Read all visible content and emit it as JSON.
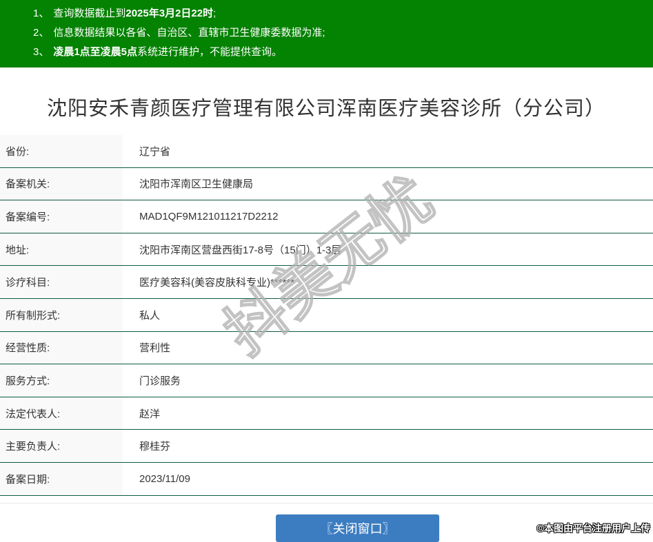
{
  "notice_bar": {
    "items": [
      {
        "num": "1、",
        "pre": "查询数据截止到",
        "bold": "2025年3月2日22时",
        "post": ";"
      },
      {
        "num": "2、",
        "pre": "信息数据结果以各省、自治区、直辖市卫生健康委数据为准;",
        "bold": "",
        "post": ""
      },
      {
        "num": "3、",
        "pre": "",
        "bold": "凌晨1点至凌晨5点",
        "post": "系统进行维护，不能提供查询。"
      }
    ]
  },
  "page_title": "沈阳安禾青颜医疗管理有限公司浑南医疗美容诊所（分公司）",
  "info_table": {
    "rows": [
      {
        "label": "省份:",
        "value": "辽宁省"
      },
      {
        "label": "备案机关:",
        "value": "沈阳市浑南区卫生健康局"
      },
      {
        "label": "备案编号:",
        "value": "MAD1QF9M121011217D2212"
      },
      {
        "label": "地址:",
        "value": "沈阳市浑南区营盘西街17-8号（15门）1-3层"
      },
      {
        "label": "诊疗科目:",
        "value": "医疗美容科(美容皮肤科专业)******"
      },
      {
        "label": "所有制形式:",
        "value": "私人"
      },
      {
        "label": "经营性质:",
        "value": "营利性"
      },
      {
        "label": "服务方式:",
        "value": "门诊服务"
      },
      {
        "label": "法定代表人:",
        "value": "赵洋"
      },
      {
        "label": "主要负责人:",
        "value": "穆桂芬"
      },
      {
        "label": "备案日期:",
        "value": "2023/11/09"
      }
    ]
  },
  "footer": {
    "close_button_label": "〖关闭窗口〗"
  },
  "watermarks": {
    "diagonal": "抖美无忧",
    "corner": "©本图由平台注册用户上传"
  },
  "colors": {
    "header_green": "#048202",
    "row_border_green": "#0b5c40",
    "button_blue": "#3c7dc1",
    "label_cell_bg": "#f9f9f9"
  }
}
